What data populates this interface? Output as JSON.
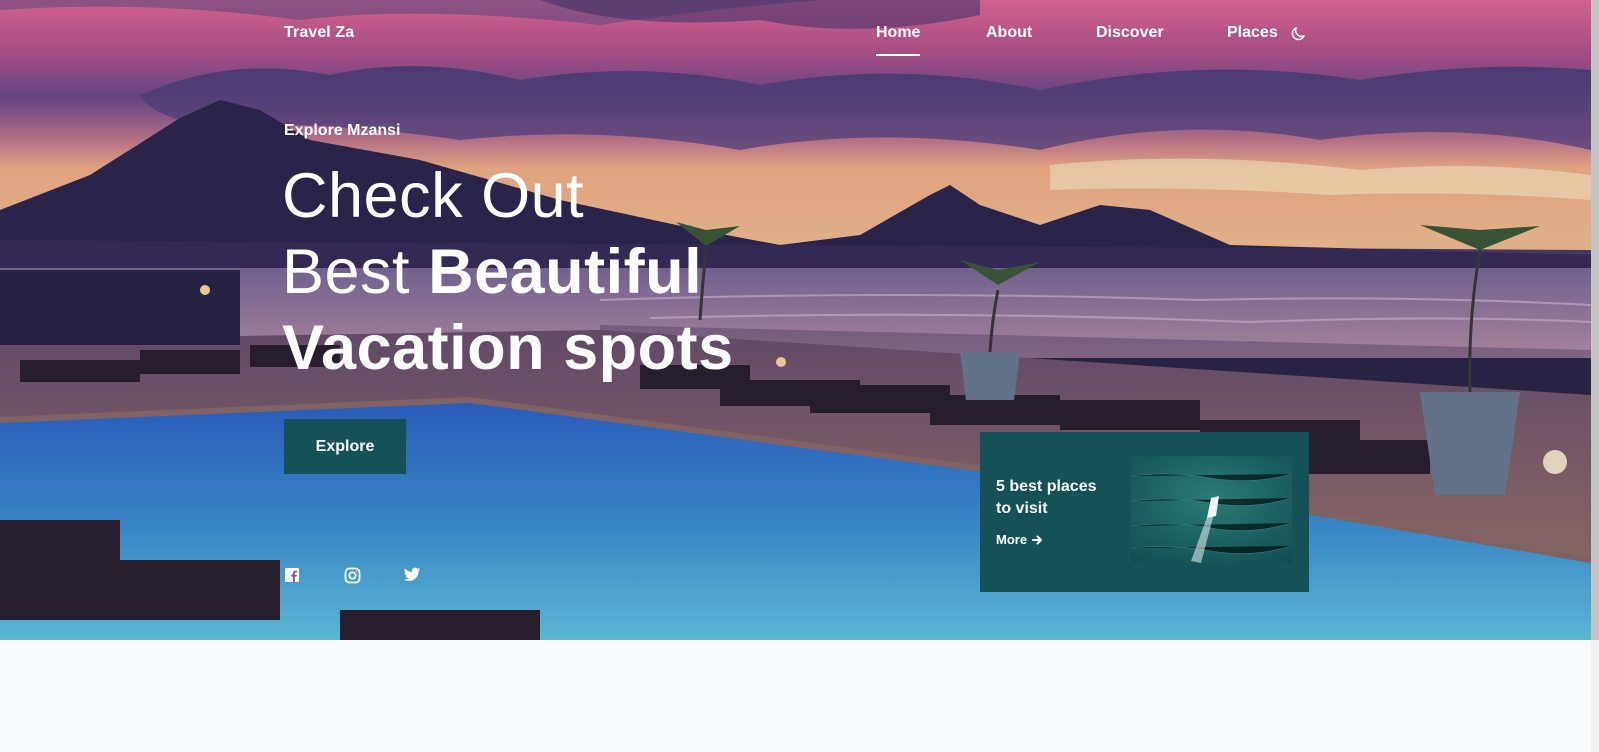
{
  "header": {
    "brand": "Travel Za",
    "nav": [
      "Home",
      "About",
      "Discover",
      "Places"
    ],
    "active_nav": "Home",
    "theme_icon": "moon-icon"
  },
  "hero": {
    "subtitle": "Explore Mzansi",
    "headline": {
      "line1": "Check Out",
      "line2_regular": "Best",
      "line2_bold": "Beautiful",
      "line3_bold": "Vacation spots"
    },
    "explore_label": "Explore",
    "socials": [
      "facebook-icon",
      "instagram-icon",
      "twitter-icon"
    ]
  },
  "card": {
    "title": "5 best places to visit",
    "more_label": "More",
    "more_icon": "arrow-right-icon",
    "image": "boat-on-ocean-aerial"
  },
  "colors": {
    "accent": "#145257",
    "text": "#ffffff",
    "page_bg": "#f7fbfd"
  }
}
